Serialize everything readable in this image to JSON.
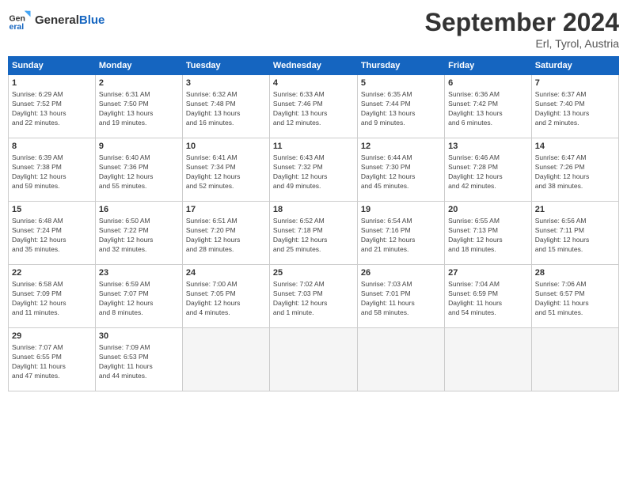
{
  "header": {
    "logo_general": "General",
    "logo_blue": "Blue",
    "month_title": "September 2024",
    "subtitle": "Erl, Tyrol, Austria"
  },
  "weekdays": [
    "Sunday",
    "Monday",
    "Tuesday",
    "Wednesday",
    "Thursday",
    "Friday",
    "Saturday"
  ],
  "weeks": [
    [
      {
        "day": "1",
        "info": "Sunrise: 6:29 AM\nSunset: 7:52 PM\nDaylight: 13 hours\nand 22 minutes."
      },
      {
        "day": "2",
        "info": "Sunrise: 6:31 AM\nSunset: 7:50 PM\nDaylight: 13 hours\nand 19 minutes."
      },
      {
        "day": "3",
        "info": "Sunrise: 6:32 AM\nSunset: 7:48 PM\nDaylight: 13 hours\nand 16 minutes."
      },
      {
        "day": "4",
        "info": "Sunrise: 6:33 AM\nSunset: 7:46 PM\nDaylight: 13 hours\nand 12 minutes."
      },
      {
        "day": "5",
        "info": "Sunrise: 6:35 AM\nSunset: 7:44 PM\nDaylight: 13 hours\nand 9 minutes."
      },
      {
        "day": "6",
        "info": "Sunrise: 6:36 AM\nSunset: 7:42 PM\nDaylight: 13 hours\nand 6 minutes."
      },
      {
        "day": "7",
        "info": "Sunrise: 6:37 AM\nSunset: 7:40 PM\nDaylight: 13 hours\nand 2 minutes."
      }
    ],
    [
      {
        "day": "8",
        "info": "Sunrise: 6:39 AM\nSunset: 7:38 PM\nDaylight: 12 hours\nand 59 minutes."
      },
      {
        "day": "9",
        "info": "Sunrise: 6:40 AM\nSunset: 7:36 PM\nDaylight: 12 hours\nand 55 minutes."
      },
      {
        "day": "10",
        "info": "Sunrise: 6:41 AM\nSunset: 7:34 PM\nDaylight: 12 hours\nand 52 minutes."
      },
      {
        "day": "11",
        "info": "Sunrise: 6:43 AM\nSunset: 7:32 PM\nDaylight: 12 hours\nand 49 minutes."
      },
      {
        "day": "12",
        "info": "Sunrise: 6:44 AM\nSunset: 7:30 PM\nDaylight: 12 hours\nand 45 minutes."
      },
      {
        "day": "13",
        "info": "Sunrise: 6:46 AM\nSunset: 7:28 PM\nDaylight: 12 hours\nand 42 minutes."
      },
      {
        "day": "14",
        "info": "Sunrise: 6:47 AM\nSunset: 7:26 PM\nDaylight: 12 hours\nand 38 minutes."
      }
    ],
    [
      {
        "day": "15",
        "info": "Sunrise: 6:48 AM\nSunset: 7:24 PM\nDaylight: 12 hours\nand 35 minutes."
      },
      {
        "day": "16",
        "info": "Sunrise: 6:50 AM\nSunset: 7:22 PM\nDaylight: 12 hours\nand 32 minutes."
      },
      {
        "day": "17",
        "info": "Sunrise: 6:51 AM\nSunset: 7:20 PM\nDaylight: 12 hours\nand 28 minutes."
      },
      {
        "day": "18",
        "info": "Sunrise: 6:52 AM\nSunset: 7:18 PM\nDaylight: 12 hours\nand 25 minutes."
      },
      {
        "day": "19",
        "info": "Sunrise: 6:54 AM\nSunset: 7:16 PM\nDaylight: 12 hours\nand 21 minutes."
      },
      {
        "day": "20",
        "info": "Sunrise: 6:55 AM\nSunset: 7:13 PM\nDaylight: 12 hours\nand 18 minutes."
      },
      {
        "day": "21",
        "info": "Sunrise: 6:56 AM\nSunset: 7:11 PM\nDaylight: 12 hours\nand 15 minutes."
      }
    ],
    [
      {
        "day": "22",
        "info": "Sunrise: 6:58 AM\nSunset: 7:09 PM\nDaylight: 12 hours\nand 11 minutes."
      },
      {
        "day": "23",
        "info": "Sunrise: 6:59 AM\nSunset: 7:07 PM\nDaylight: 12 hours\nand 8 minutes."
      },
      {
        "day": "24",
        "info": "Sunrise: 7:00 AM\nSunset: 7:05 PM\nDaylight: 12 hours\nand 4 minutes."
      },
      {
        "day": "25",
        "info": "Sunrise: 7:02 AM\nSunset: 7:03 PM\nDaylight: 12 hours\nand 1 minute."
      },
      {
        "day": "26",
        "info": "Sunrise: 7:03 AM\nSunset: 7:01 PM\nDaylight: 11 hours\nand 58 minutes."
      },
      {
        "day": "27",
        "info": "Sunrise: 7:04 AM\nSunset: 6:59 PM\nDaylight: 11 hours\nand 54 minutes."
      },
      {
        "day": "28",
        "info": "Sunrise: 7:06 AM\nSunset: 6:57 PM\nDaylight: 11 hours\nand 51 minutes."
      }
    ],
    [
      {
        "day": "29",
        "info": "Sunrise: 7:07 AM\nSunset: 6:55 PM\nDaylight: 11 hours\nand 47 minutes."
      },
      {
        "day": "30",
        "info": "Sunrise: 7:09 AM\nSunset: 6:53 PM\nDaylight: 11 hours\nand 44 minutes."
      },
      null,
      null,
      null,
      null,
      null
    ]
  ]
}
